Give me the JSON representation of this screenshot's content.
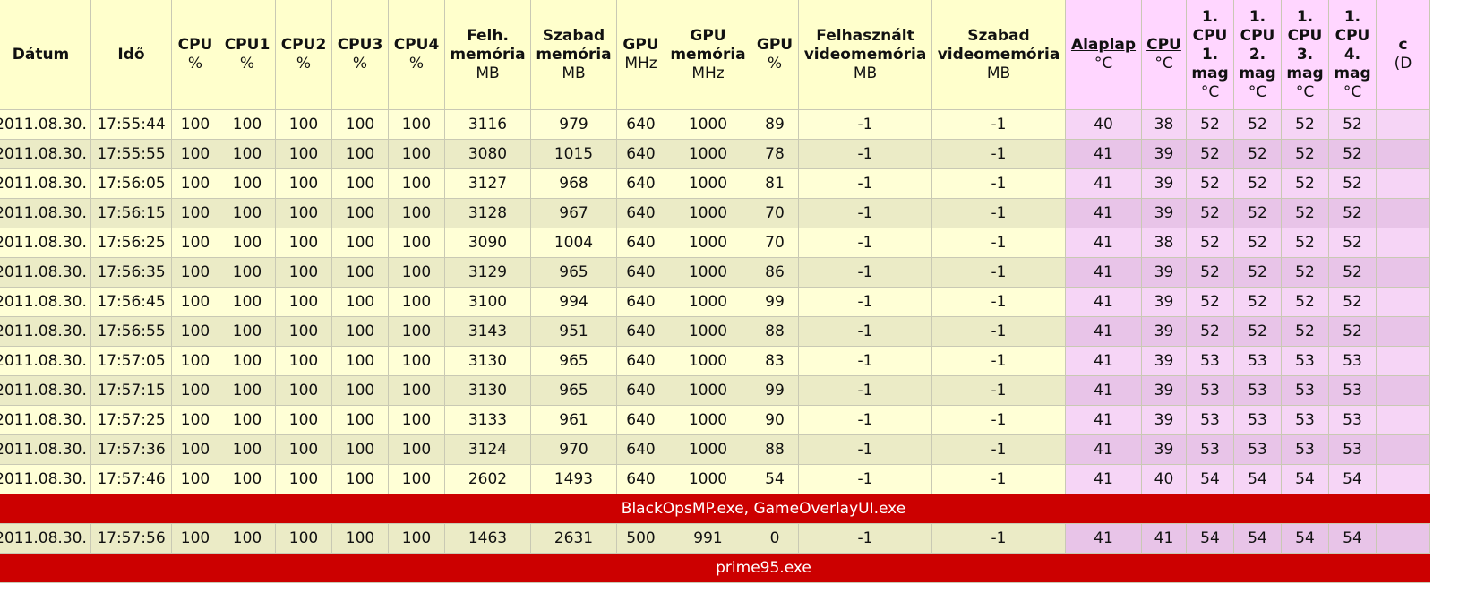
{
  "headers": [
    {
      "key": "datum",
      "title": "Dátum",
      "unit": ""
    },
    {
      "key": "ido",
      "title": "Idő",
      "unit": ""
    },
    {
      "key": "cpu",
      "title": "CPU",
      "unit": "%"
    },
    {
      "key": "cpu1",
      "title": "CPU1",
      "unit": "%"
    },
    {
      "key": "cpu2",
      "title": "CPU2",
      "unit": "%"
    },
    {
      "key": "cpu3",
      "title": "CPU3",
      "unit": "%"
    },
    {
      "key": "cpu4",
      "title": "CPU4",
      "unit": "%"
    },
    {
      "key": "felh_mem",
      "title": "Felh.\nmemória",
      "unit": "MB"
    },
    {
      "key": "szabad_mem",
      "title": "Szabad\nmemória",
      "unit": "MB"
    },
    {
      "key": "gpu_mhz",
      "title": "GPU",
      "unit": "MHz"
    },
    {
      "key": "gpu_mem",
      "title": "GPU\nmemória",
      "unit": "MHz"
    },
    {
      "key": "gpu_pct",
      "title": "GPU",
      "unit": "%"
    },
    {
      "key": "felh_vmem",
      "title": "Felhasznált\nvideomemória",
      "unit": "MB"
    },
    {
      "key": "szabad_vmem",
      "title": "Szabad\nvideomemória",
      "unit": "MB"
    },
    {
      "key": "alaplap",
      "title": "Alaplap",
      "unit": "°C",
      "underline": true
    },
    {
      "key": "cpu_temp",
      "title": "CPU",
      "unit": "°C",
      "underline": true
    },
    {
      "key": "core1",
      "title": "1.\nCPU\n1.\nmag",
      "unit": "°C"
    },
    {
      "key": "core2",
      "title": "1.\nCPU\n2.\nmag",
      "unit": "°C"
    },
    {
      "key": "core3",
      "title": "1.\nCPU\n3.\nmag",
      "unit": "°C"
    },
    {
      "key": "core4",
      "title": "1.\nCPU\n4.\nmag",
      "unit": "°C"
    },
    {
      "key": "extra",
      "title": "c",
      "unit": "(D"
    }
  ],
  "rows": [
    {
      "type": "data",
      "cells": [
        "2011.08.30.",
        "17:55:44",
        "100",
        "100",
        "100",
        "100",
        "100",
        "3116",
        "979",
        "640",
        "1000",
        "89",
        "-1",
        "-1",
        "40",
        "38",
        "52",
        "52",
        "52",
        "52",
        ""
      ]
    },
    {
      "type": "data",
      "cells": [
        "2011.08.30.",
        "17:55:55",
        "100",
        "100",
        "100",
        "100",
        "100",
        "3080",
        "1015",
        "640",
        "1000",
        "78",
        "-1",
        "-1",
        "41",
        "39",
        "52",
        "52",
        "52",
        "52",
        ""
      ]
    },
    {
      "type": "data",
      "cells": [
        "2011.08.30.",
        "17:56:05",
        "100",
        "100",
        "100",
        "100",
        "100",
        "3127",
        "968",
        "640",
        "1000",
        "81",
        "-1",
        "-1",
        "41",
        "39",
        "52",
        "52",
        "52",
        "52",
        ""
      ]
    },
    {
      "type": "data",
      "cells": [
        "2011.08.30.",
        "17:56:15",
        "100",
        "100",
        "100",
        "100",
        "100",
        "3128",
        "967",
        "640",
        "1000",
        "70",
        "-1",
        "-1",
        "41",
        "39",
        "52",
        "52",
        "52",
        "52",
        ""
      ]
    },
    {
      "type": "data",
      "cells": [
        "2011.08.30.",
        "17:56:25",
        "100",
        "100",
        "100",
        "100",
        "100",
        "3090",
        "1004",
        "640",
        "1000",
        "70",
        "-1",
        "-1",
        "41",
        "38",
        "52",
        "52",
        "52",
        "52",
        ""
      ]
    },
    {
      "type": "data",
      "cells": [
        "2011.08.30.",
        "17:56:35",
        "100",
        "100",
        "100",
        "100",
        "100",
        "3129",
        "965",
        "640",
        "1000",
        "86",
        "-1",
        "-1",
        "41",
        "39",
        "52",
        "52",
        "52",
        "52",
        ""
      ]
    },
    {
      "type": "data",
      "cells": [
        "2011.08.30.",
        "17:56:45",
        "100",
        "100",
        "100",
        "100",
        "100",
        "3100",
        "994",
        "640",
        "1000",
        "99",
        "-1",
        "-1",
        "41",
        "39",
        "52",
        "52",
        "52",
        "52",
        ""
      ]
    },
    {
      "type": "data",
      "cells": [
        "2011.08.30.",
        "17:56:55",
        "100",
        "100",
        "100",
        "100",
        "100",
        "3143",
        "951",
        "640",
        "1000",
        "88",
        "-1",
        "-1",
        "41",
        "39",
        "52",
        "52",
        "52",
        "52",
        ""
      ]
    },
    {
      "type": "data",
      "cells": [
        "2011.08.30.",
        "17:57:05",
        "100",
        "100",
        "100",
        "100",
        "100",
        "3130",
        "965",
        "640",
        "1000",
        "83",
        "-1",
        "-1",
        "41",
        "39",
        "53",
        "53",
        "53",
        "53",
        ""
      ]
    },
    {
      "type": "data",
      "cells": [
        "2011.08.30.",
        "17:57:15",
        "100",
        "100",
        "100",
        "100",
        "100",
        "3130",
        "965",
        "640",
        "1000",
        "99",
        "-1",
        "-1",
        "41",
        "39",
        "53",
        "53",
        "53",
        "53",
        ""
      ]
    },
    {
      "type": "data",
      "cells": [
        "2011.08.30.",
        "17:57:25",
        "100",
        "100",
        "100",
        "100",
        "100",
        "3133",
        "961",
        "640",
        "1000",
        "90",
        "-1",
        "-1",
        "41",
        "39",
        "53",
        "53",
        "53",
        "53",
        ""
      ]
    },
    {
      "type": "data",
      "cells": [
        "2011.08.30.",
        "17:57:36",
        "100",
        "100",
        "100",
        "100",
        "100",
        "3124",
        "970",
        "640",
        "1000",
        "88",
        "-1",
        "-1",
        "41",
        "39",
        "53",
        "53",
        "53",
        "53",
        ""
      ]
    },
    {
      "type": "data",
      "cells": [
        "2011.08.30.",
        "17:57:46",
        "100",
        "100",
        "100",
        "100",
        "100",
        "2602",
        "1493",
        "640",
        "1000",
        "54",
        "-1",
        "-1",
        "41",
        "40",
        "54",
        "54",
        "54",
        "54",
        ""
      ]
    },
    {
      "type": "event",
      "text": "BlackOpsMP.exe, GameOverlayUI.exe"
    },
    {
      "type": "data",
      "cells": [
        "2011.08.30.",
        "17:57:56",
        "100",
        "100",
        "100",
        "100",
        "100",
        "1463",
        "2631",
        "500",
        "991",
        "0",
        "-1",
        "-1",
        "41",
        "41",
        "54",
        "54",
        "54",
        "54",
        ""
      ]
    },
    {
      "type": "event",
      "text": "prime95.exe"
    }
  ],
  "colors": {
    "header_bg": "#ffffcc",
    "temp_header_bg": "#ffd6ff",
    "row_bg": "#ffffd6",
    "row_alt_bg": "#ebebc6",
    "temp_cell_bg": "#f6d5f6",
    "event_bg": "#cc0000",
    "event_text": "#ffffff"
  }
}
